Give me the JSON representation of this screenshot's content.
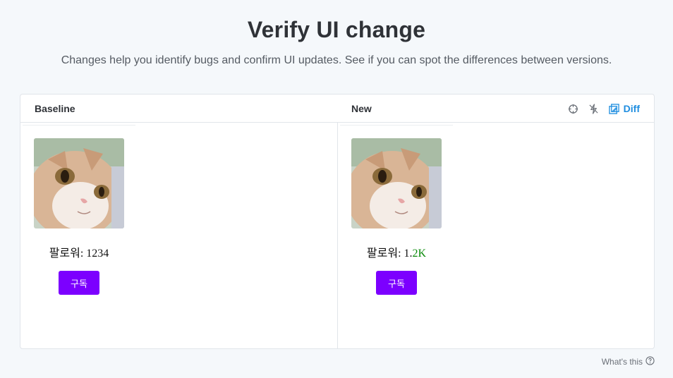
{
  "header": {
    "title": "Verify UI change",
    "subtitle": "Changes help you identify bugs and confirm UI updates. See if you can spot the differences between versions."
  },
  "panel": {
    "baseline_label": "Baseline",
    "new_label": "New",
    "diff_label": "Diff",
    "tools": [
      "crosshair-icon",
      "strobe-off-icon",
      "diff-icon"
    ]
  },
  "baseline": {
    "followers_prefix": "팔로워: ",
    "followers_value": "1234",
    "subscribe_label": "구독"
  },
  "new": {
    "followers_prefix": "팔로워",
    "followers_colon": ": 1.",
    "followers_changed": "2K",
    "subscribe_label": "구독"
  },
  "footer": {
    "whats_this": "What's this"
  },
  "colors": {
    "accent": "#1f8ee0",
    "button": "#7c00ff",
    "diff_highlight": "#0a8a0a"
  }
}
